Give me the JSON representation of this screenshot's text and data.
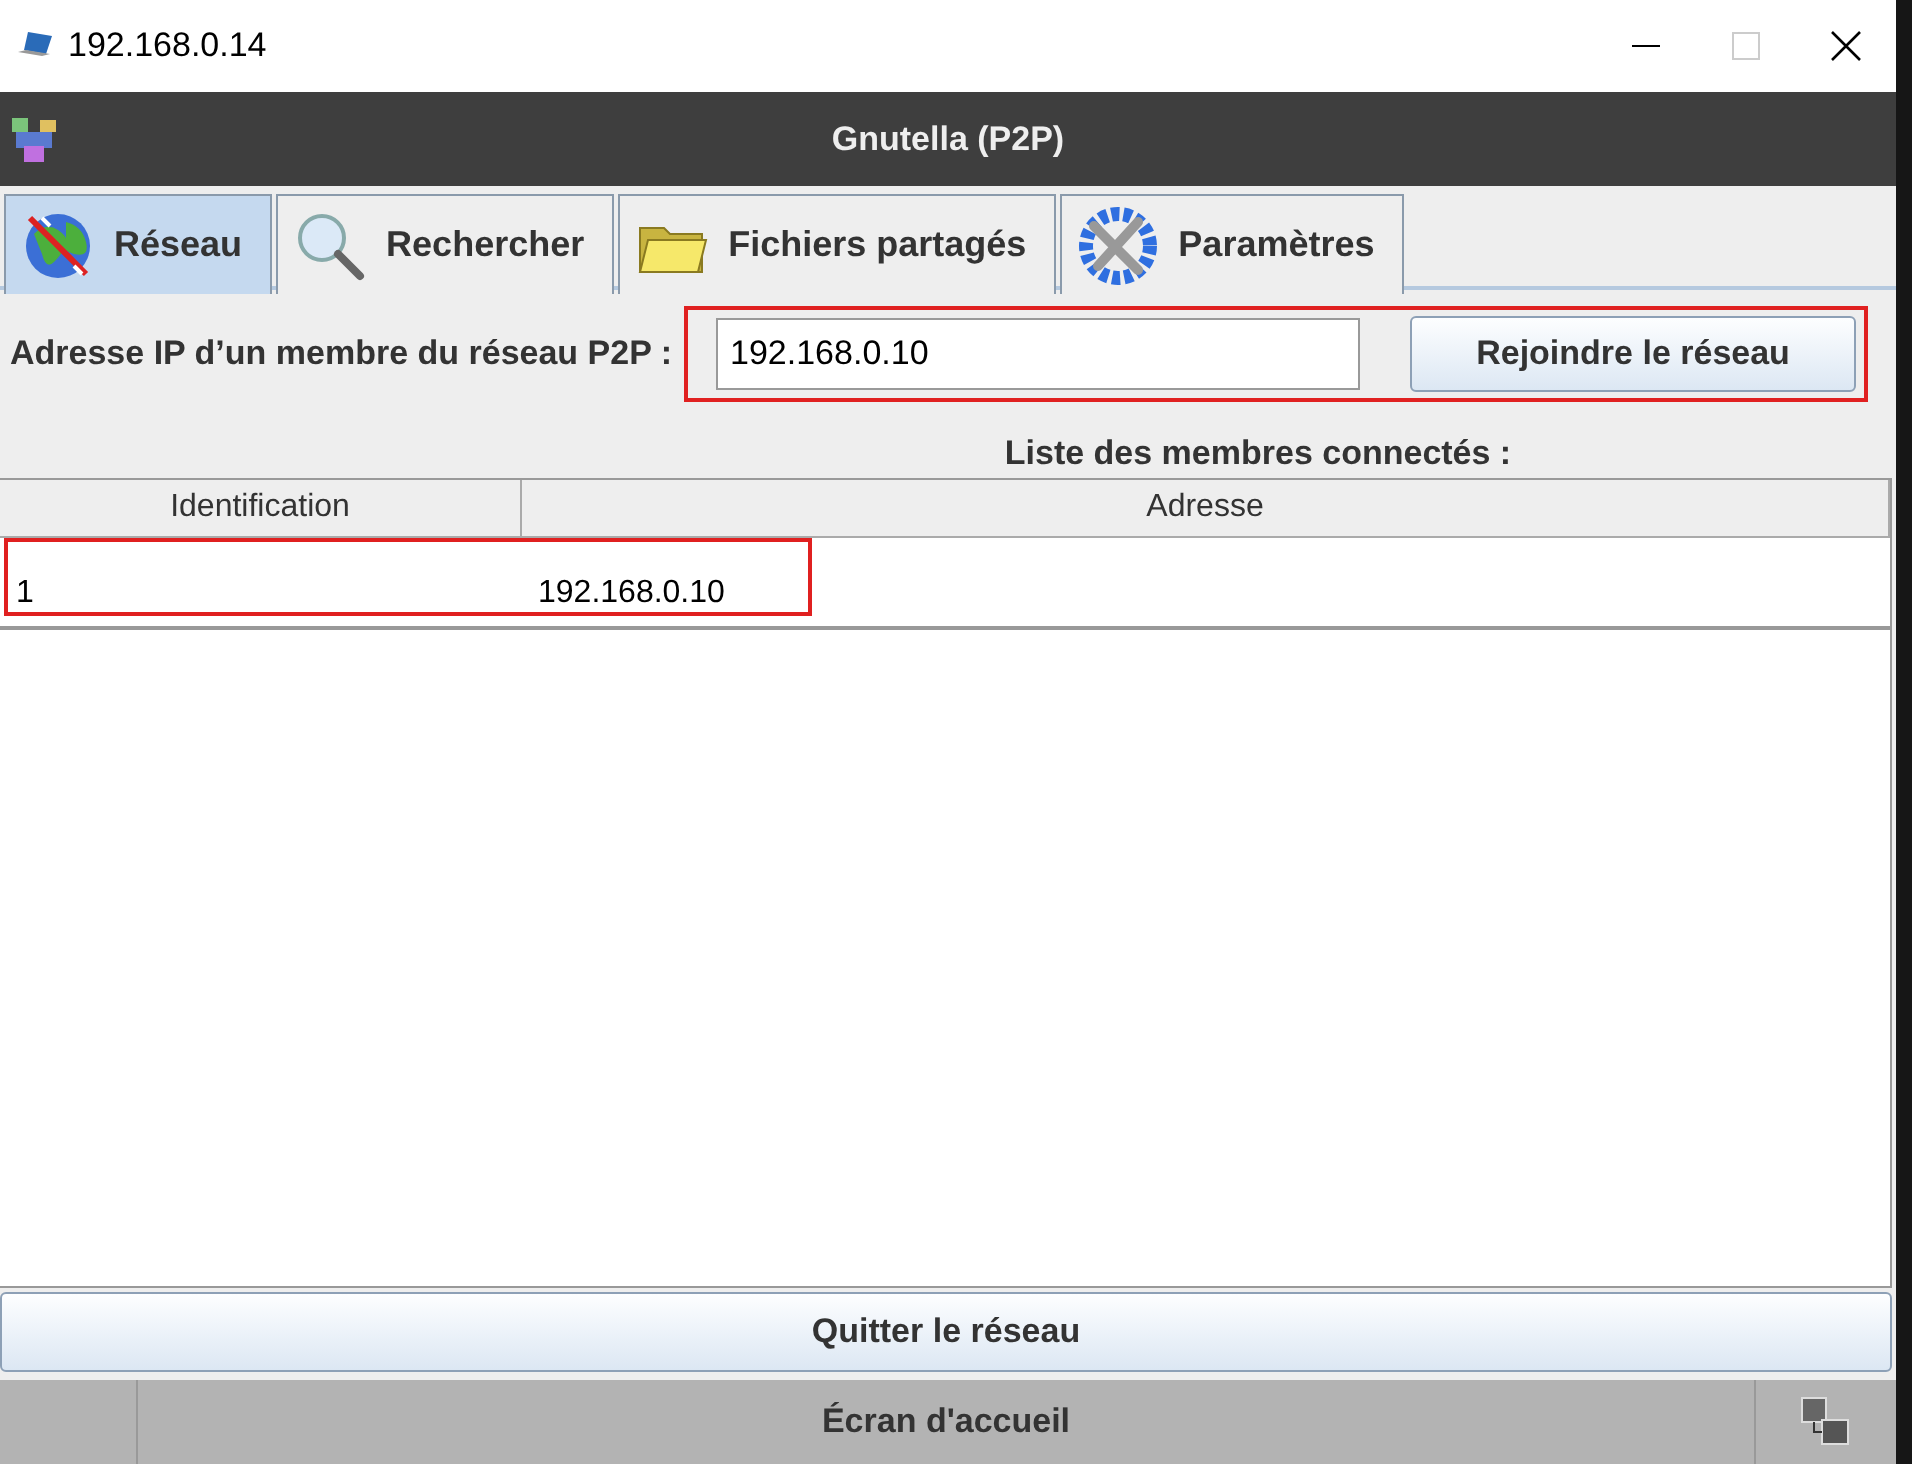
{
  "window": {
    "title": "192.168.0.14"
  },
  "app": {
    "title": "Gnutella (P2P)"
  },
  "tabs": [
    {
      "label": "Réseau",
      "selected": true
    },
    {
      "label": "Rechercher",
      "selected": false
    },
    {
      "label": "Fichiers partagés",
      "selected": false
    },
    {
      "label": "Paramètres",
      "selected": false
    }
  ],
  "join_form": {
    "label": "Adresse IP d’un membre du réseau P2P :",
    "value": "192.168.0.10",
    "button": "Rejoindre le réseau",
    "highlighted": true
  },
  "members": {
    "title": "Liste des membres connectés :",
    "columns": [
      "Identification",
      "Adresse"
    ],
    "rows": [
      {
        "cells": [
          "1",
          "192.168.0.10"
        ],
        "highlighted": true
      }
    ]
  },
  "quit_button": "Quitter le réseau",
  "bottom_bar": {
    "label": "Écran d'accueil"
  }
}
